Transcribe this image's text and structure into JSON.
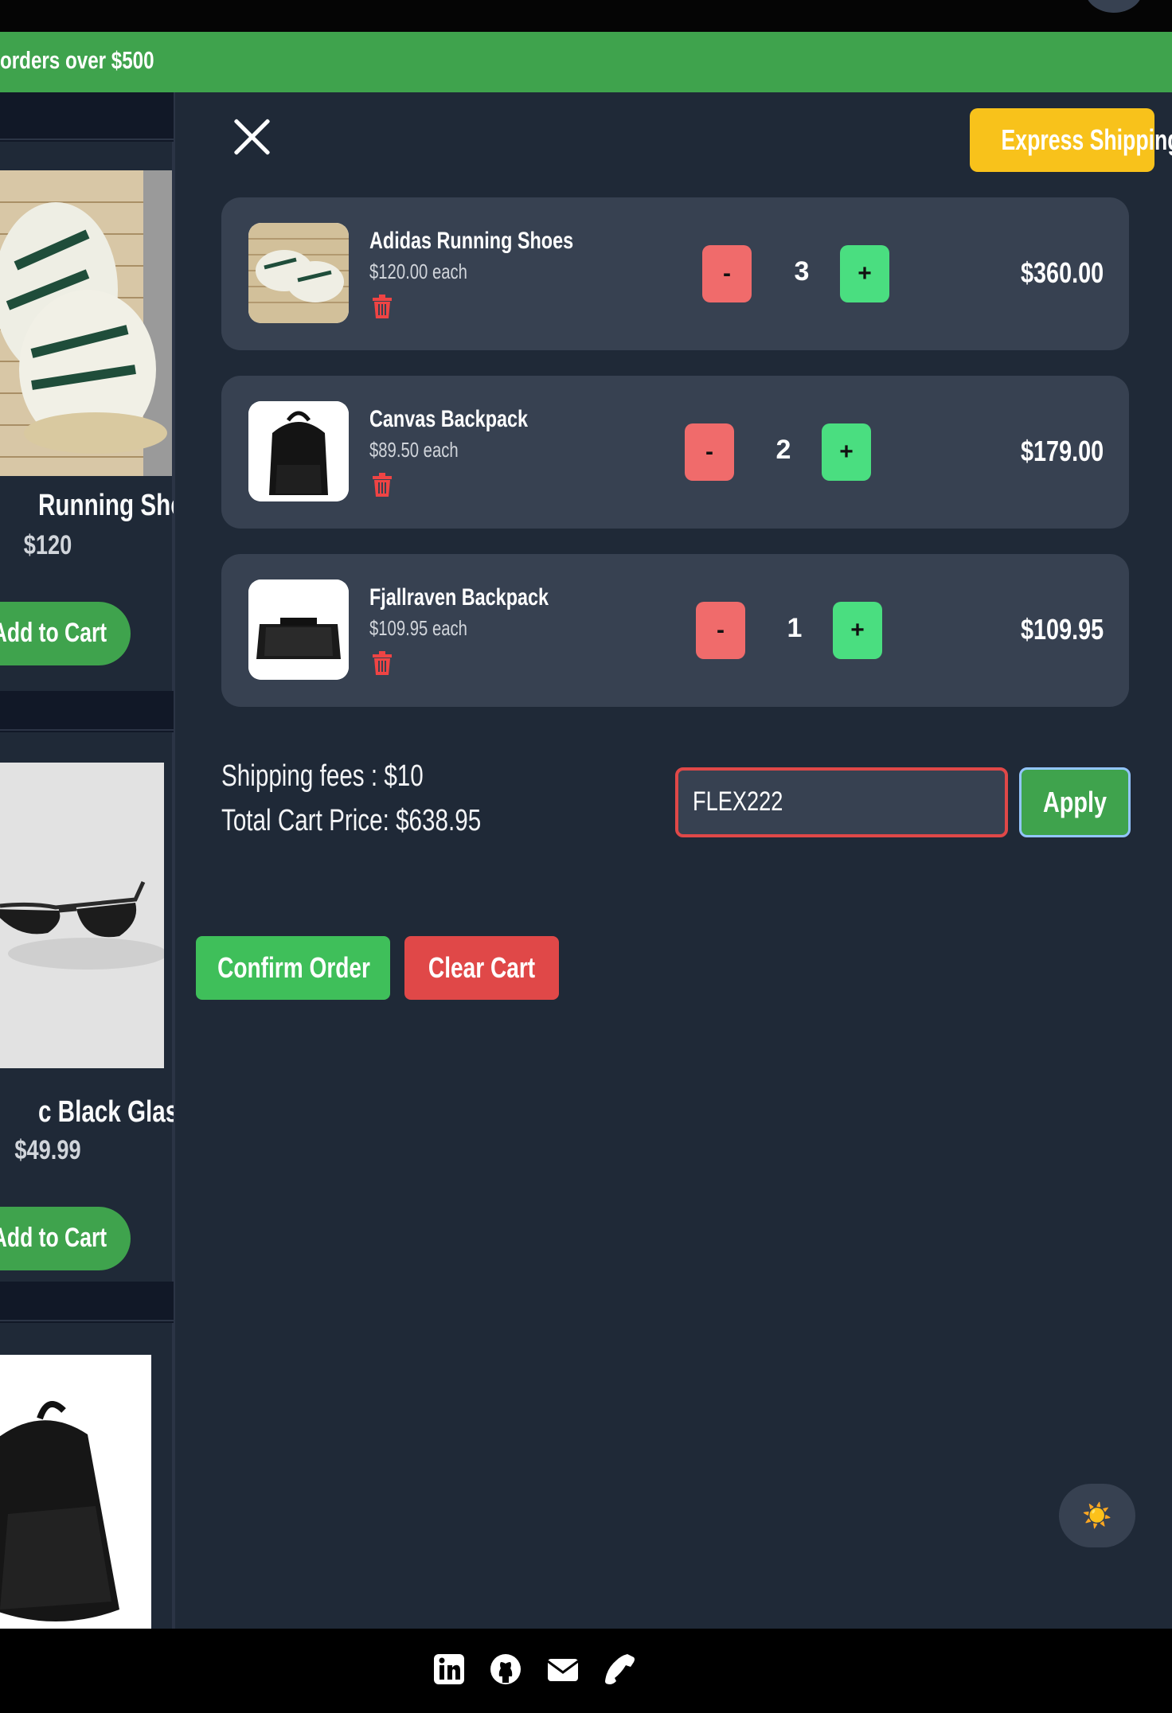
{
  "promo": {
    "text": "orders over $500"
  },
  "products": [
    {
      "name": "Running Shoes",
      "price": "$120",
      "button": "Add to Cart"
    },
    {
      "name": "c Black Glasses",
      "price": "$49.99",
      "button": "Add to Cart"
    }
  ],
  "cart": {
    "express_label": "Express Shipping",
    "items": [
      {
        "name": "Adidas Running Shoes",
        "each": "$120.00 each",
        "qty": "3",
        "total": "$360.00",
        "minus": "-",
        "plus": "+"
      },
      {
        "name": "Canvas Backpack",
        "each": "$89.50 each",
        "qty": "2",
        "total": "$179.00",
        "minus": "-",
        "plus": "+"
      },
      {
        "name": "Fjallraven Backpack",
        "each": "$109.95 each",
        "qty": "1",
        "total": "$109.95",
        "minus": "-",
        "plus": "+"
      }
    ],
    "shipping": "Shipping fees : $10",
    "total": "Total Cart Price: $638.95",
    "coupon_value": "FLEX222",
    "apply_label": "Apply",
    "confirm_label": "Confirm Order",
    "clear_label": "Clear Cart"
  },
  "theme_toggle": {
    "icon": "☀️"
  },
  "colors": {
    "green": "#3fa34d",
    "red": "#e04848",
    "yellow": "#f8c21b",
    "panel": "#1f2937"
  },
  "footer": {
    "icons": [
      "linkedin-icon",
      "github-icon",
      "mail-icon",
      "phone-icon"
    ]
  }
}
